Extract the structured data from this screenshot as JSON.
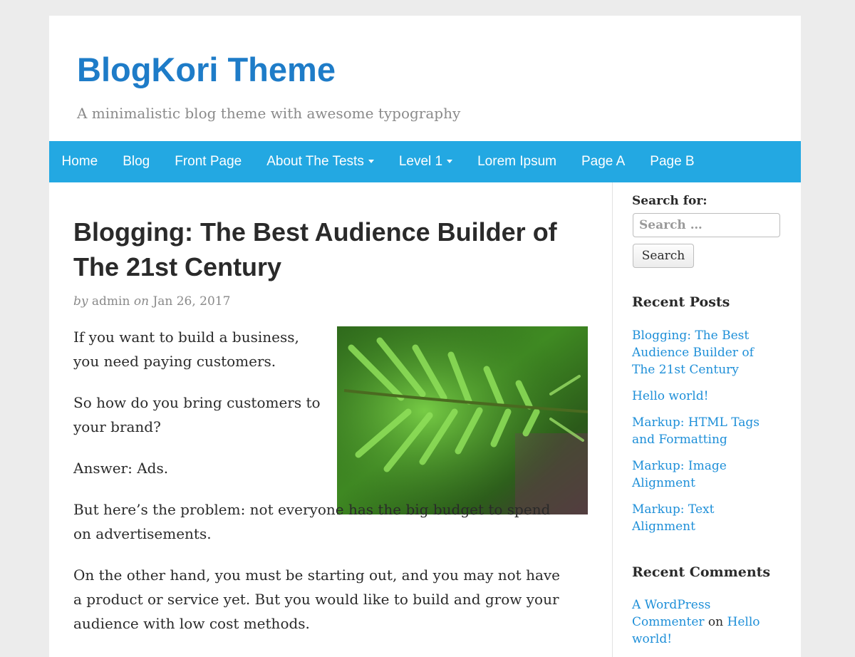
{
  "site": {
    "title": "BlogKori Theme",
    "tagline": "A minimalistic blog theme with awesome typography"
  },
  "nav": {
    "items": [
      {
        "label": "Home",
        "dropdown": false
      },
      {
        "label": "Blog",
        "dropdown": false
      },
      {
        "label": "Front Page",
        "dropdown": false
      },
      {
        "label": "About The Tests",
        "dropdown": true
      },
      {
        "label": "Level 1",
        "dropdown": true
      },
      {
        "label": "Lorem Ipsum",
        "dropdown": false
      },
      {
        "label": "Page A",
        "dropdown": false
      },
      {
        "label": "Page B",
        "dropdown": false
      }
    ]
  },
  "post": {
    "title": "Blogging: The Best Audience Builder of The 21st Century",
    "meta_by": "by",
    "author": "admin",
    "meta_on": "on",
    "date": "Jan 26, 2017",
    "paragraphs": [
      "If you want to build a business, you need paying customers.",
      "So how do you bring customers to your brand?",
      "Answer: Ads.",
      "But here’s the problem: not everyone has the big budget to spend on advertisements.",
      "On the other hand, you must be starting out, and you may not have a product or service yet. But you would like to build and grow your audience with low cost methods."
    ]
  },
  "sidebar": {
    "search_label": "Search for:",
    "search_placeholder": "Search …",
    "search_button": "Search",
    "recent_posts_title": "Recent Posts",
    "recent_posts": [
      "Blogging: The Best Audience Builder of The 21st Century",
      "Hello world!",
      "Markup: HTML Tags and Formatting",
      "Markup: Image Alignment",
      "Markup: Text Alignment"
    ],
    "recent_comments_title": "Recent Comments",
    "recent_comments": [
      {
        "author": "A WordPress Commenter",
        "on": "on",
        "post": "Hello world!"
      }
    ]
  },
  "colors": {
    "brand": "#1e7cc8",
    "nav_background": "#23a8e2",
    "link": "#1e8fd8"
  }
}
